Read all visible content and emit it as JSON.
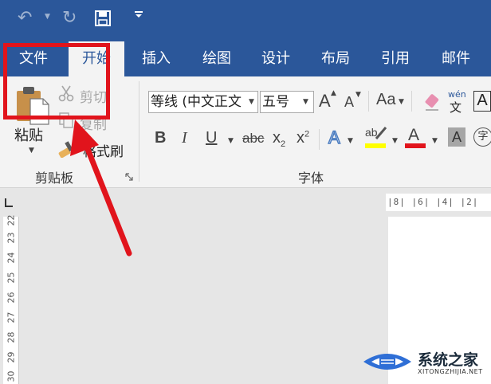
{
  "tabs": [
    {
      "label": "文件"
    },
    {
      "label": "开始"
    },
    {
      "label": "插入"
    },
    {
      "label": "绘图"
    },
    {
      "label": "设计"
    },
    {
      "label": "布局"
    },
    {
      "label": "引用"
    },
    {
      "label": "邮件"
    }
  ],
  "clipboard": {
    "paste_label": "粘贴",
    "cut_label": "剪切",
    "copy_label": "复制",
    "format_painter_label": "格式刷",
    "group_label": "剪贴板"
  },
  "font": {
    "font_name": "等线 (中文正文",
    "font_size": "五号",
    "grow_label": "A",
    "shrink_label": "A",
    "case_label": "Aa",
    "pinyin_top": "wén",
    "pinyin_bottom": "文",
    "border_char_label": "A",
    "bold": "B",
    "italic": "I",
    "underline": "U",
    "strike": "abc",
    "subscript": "x",
    "subscript_mark": "2",
    "superscript": "x",
    "superscript_mark": "2",
    "effects_label": "A",
    "highlight_label": "ab",
    "font_color_label": "A",
    "shading_label": "A",
    "enclose_label": "字",
    "group_label": "字体"
  },
  "ruler": {
    "horizontal": "|8|  |6|  |4|  |2|",
    "vertical": [
      "22",
      "23",
      "24",
      "25",
      "26",
      "27",
      "28",
      "29",
      "30"
    ]
  },
  "watermark": {
    "title": "系统之家",
    "subtitle": "XITONGZHIJIA.NET"
  },
  "colors": {
    "accent": "#2b579a",
    "annotation": "#e1141c",
    "highlight_bar": "#ffff00",
    "font_color_bar": "#e1141c"
  }
}
